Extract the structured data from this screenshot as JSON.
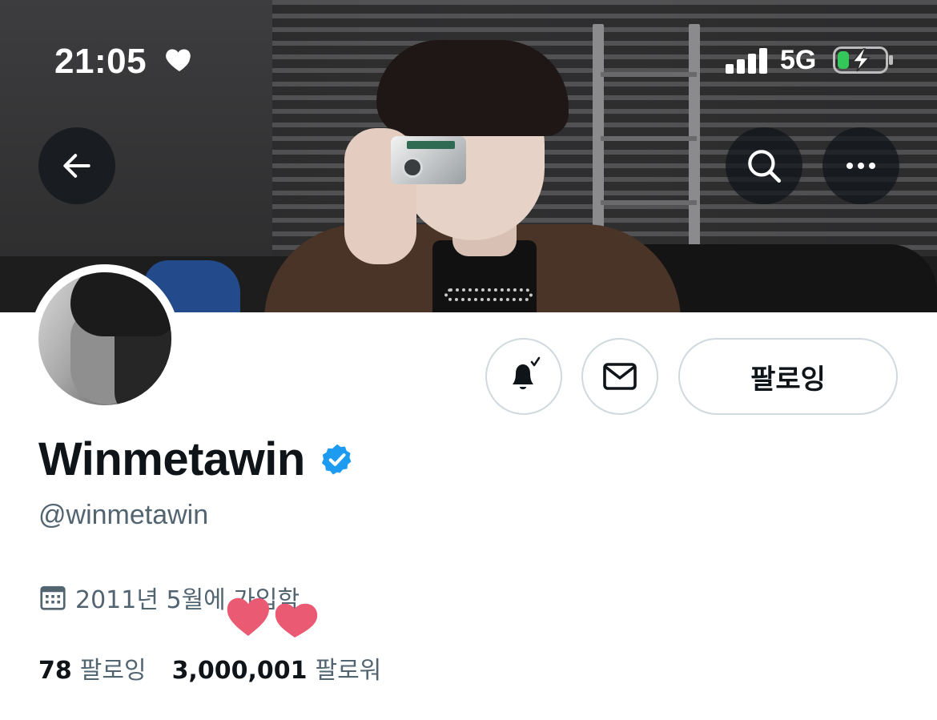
{
  "status_bar": {
    "time": "21:05",
    "network": "5G",
    "icons": [
      "heart-icon",
      "signal-icon",
      "battery-charging-icon"
    ]
  },
  "header": {
    "back_icon": "arrow-left-icon",
    "search_icon": "search-icon",
    "more_icon": "more-horizontal-icon"
  },
  "actions": {
    "notifications_icon": "bell-subscribed-icon",
    "message_icon": "envelope-icon",
    "following_label": "팔로잉"
  },
  "profile": {
    "display_name": "Winmetawin",
    "verified": true,
    "handle": "@winmetawin",
    "joined": "2011년 5월에 가입함",
    "following_count": "78",
    "following_label": "팔로잉",
    "followers_count": "3,000,001",
    "followers_label": "팔로워"
  },
  "colors": {
    "verified": "#1d9bf0",
    "secondary_text": "#536471",
    "primary_text": "#0f1419",
    "border": "#cfd9de",
    "battery_fill": "#34c759",
    "heart_sticker": "#ea5a72"
  }
}
